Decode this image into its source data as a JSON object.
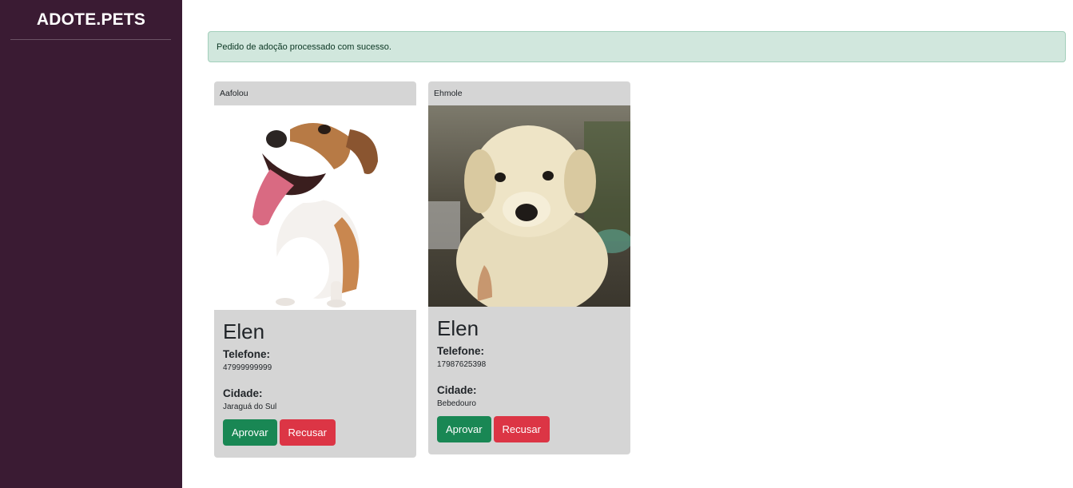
{
  "sidebar": {
    "brand": "ADOTE.PETS"
  },
  "alert": {
    "message": "Pedido de adoção processado com sucesso."
  },
  "cards": [
    {
      "pet": "Aafolou",
      "name": "Elen",
      "phone_label": "Telefone:",
      "phone": "47999999999",
      "city_label": "Cidade:",
      "city": "Jaraguá do Sul",
      "approve_label": "Aprovar",
      "reject_label": "Recusar"
    },
    {
      "pet": "Ehmole",
      "name": "Elen",
      "phone_label": "Telefone:",
      "phone": "17987625398",
      "city_label": "Cidade:",
      "city": "Bebedouro",
      "approve_label": "Aprovar",
      "reject_label": "Recusar"
    }
  ],
  "colors": {
    "sidebar": "#3a1b33",
    "alert_bg": "#d1e7dd",
    "card_bg": "#d5d5d5",
    "approve": "#198754",
    "reject": "#dc3545"
  }
}
